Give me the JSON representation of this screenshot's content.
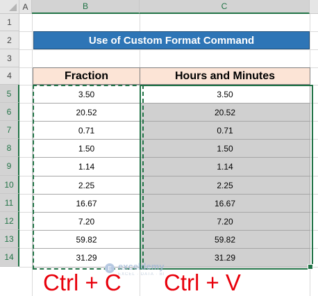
{
  "columns": [
    "A",
    "B",
    "C"
  ],
  "rows": [
    "1",
    "2",
    "3",
    "4",
    "5",
    "6",
    "7",
    "8",
    "9",
    "10",
    "11",
    "12",
    "13",
    "14"
  ],
  "title": "Use of Custom Format Command",
  "headers": {
    "fraction": "Fraction",
    "hours": "Hours and Minutes"
  },
  "fraction": [
    "3.50",
    "20.52",
    "0.71",
    "1.50",
    "1.14",
    "2.25",
    "16.67",
    "7.20",
    "59.82",
    "31.29"
  ],
  "hours": [
    "3.50",
    "20.52",
    "0.71",
    "1.50",
    "1.14",
    "2.25",
    "16.67",
    "7.20",
    "59.82",
    "31.29"
  ],
  "shortcuts": {
    "copy": "Ctrl + C",
    "paste": "Ctrl + V"
  },
  "watermark": {
    "name": "exceldemy",
    "tagline": "EXCEL · DATA · BI"
  },
  "colors": {
    "title_bg": "#2e75b6",
    "header_bg": "#fce4d6",
    "selection": "#217346",
    "shortcut_text": "#e8000b",
    "pasted_fill": "#d0d0d0"
  }
}
